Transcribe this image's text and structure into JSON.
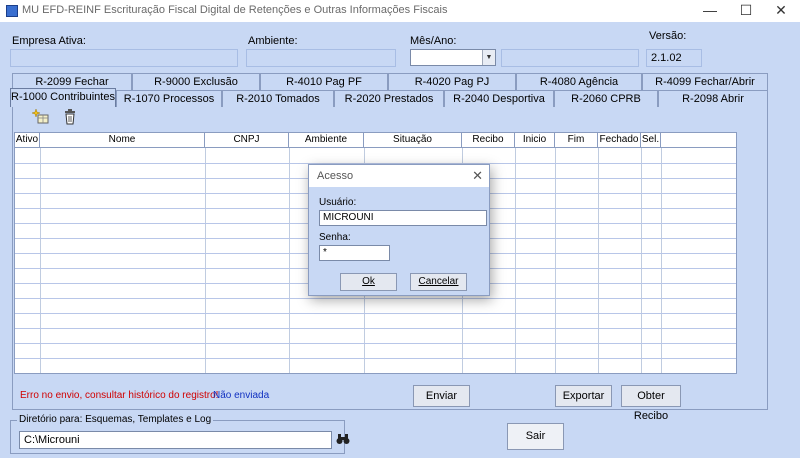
{
  "window": {
    "title": "MU EFD-REINF Escrituração Fiscal Digital de Retenções e Outras Informações Fiscais",
    "minimize": "—",
    "maximize": "☐",
    "close": "✕"
  },
  "header": {
    "empresa_label": "Empresa Ativa:",
    "empresa_value": "",
    "ambiente_label": "Ambiente:",
    "ambiente_value": "",
    "mesano_label": "Mês/Ano:",
    "mesano_value": "",
    "versao_label": "Versão:",
    "versao_value": "2.1.02"
  },
  "tabs_row1": [
    {
      "label": "R-2099 Fechar"
    },
    {
      "label": "R-9000 Exclusão"
    },
    {
      "label": "R-4010 Pag PF"
    },
    {
      "label": "R-4020 Pag PJ"
    },
    {
      "label": "R-4080 Agência"
    },
    {
      "label": "R-4099 Fechar/Abrir"
    }
  ],
  "tabs_row2": [
    {
      "label": "R-1000 Contribuintes"
    },
    {
      "label": "R-1070 Processos"
    },
    {
      "label": "R-2010 Tomados"
    },
    {
      "label": "R-2020 Prestados"
    },
    {
      "label": "R-2040 Desportiva"
    },
    {
      "label": "R-2060 CPRB"
    },
    {
      "label": "R-2098 Abrir"
    }
  ],
  "toolbar": {
    "add_icon": "add-record-icon",
    "delete_icon": "trash-icon"
  },
  "grid": {
    "columns": [
      "Ativo",
      "Nome",
      "CNPJ",
      "Ambiente",
      "Situação",
      "Recibo",
      "Inicio",
      "Fim",
      "Fechado",
      "Sel."
    ]
  },
  "status": {
    "error_text": "Erro no envio, consultar histórico do registro!",
    "pending_text": "Não enviada"
  },
  "buttons": {
    "enviar": "Enviar",
    "exportar": "Exportar",
    "obter_recibo": "Obter Recibo",
    "sair": "Sair"
  },
  "directory": {
    "legend": "Diretório para: Esquemas, Templates e Log",
    "value": "C:\\Microuni",
    "browse_icon": "binoculars-icon"
  },
  "dialog": {
    "title": "Acesso",
    "usuario_label": "Usuário:",
    "usuario_value": "MICROUNI",
    "senha_label": "Senha:",
    "senha_value": "*",
    "ok_label": "Ok",
    "cancel_label": "Cancelar"
  }
}
